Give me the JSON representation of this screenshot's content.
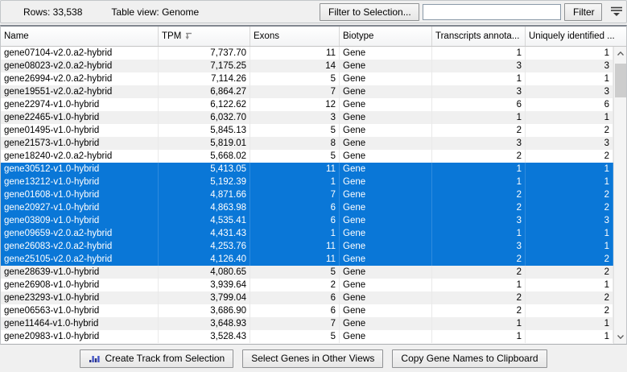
{
  "toolbar": {
    "rows_label": "Rows: 33,538",
    "view_label": "Table view: Genome",
    "filter_to_selection_label": "Filter to Selection...",
    "filter_input_value": "",
    "filter_button_label": "Filter",
    "filter_expand_icon": "filter-expand-icon"
  },
  "table": {
    "columns": [
      {
        "label": "Name",
        "sorted": false
      },
      {
        "label": "TPM",
        "sorted": true,
        "sort_icon": "sort-descending-icon"
      },
      {
        "label": "Exons",
        "sorted": false
      },
      {
        "label": "Biotype",
        "sorted": false
      },
      {
        "label": "Transcripts annota...",
        "sorted": false
      },
      {
        "label": "Uniquely identified ...",
        "sorted": false
      }
    ],
    "rows": [
      {
        "name": "gene07104-v2.0.a2-hybrid",
        "tpm": "7,737.70",
        "exons": "11",
        "biotype": "Gene",
        "transcripts": "1",
        "unique": "1",
        "selected": false
      },
      {
        "name": "gene08023-v2.0.a2-hybrid",
        "tpm": "7,175.25",
        "exons": "14",
        "biotype": "Gene",
        "transcripts": "3",
        "unique": "3",
        "selected": false
      },
      {
        "name": "gene26994-v2.0.a2-hybrid",
        "tpm": "7,114.26",
        "exons": "5",
        "biotype": "Gene",
        "transcripts": "1",
        "unique": "1",
        "selected": false
      },
      {
        "name": "gene19551-v2.0.a2-hybrid",
        "tpm": "6,864.27",
        "exons": "7",
        "biotype": "Gene",
        "transcripts": "3",
        "unique": "3",
        "selected": false
      },
      {
        "name": "gene22974-v1.0-hybrid",
        "tpm": "6,122.62",
        "exons": "12",
        "biotype": "Gene",
        "transcripts": "6",
        "unique": "6",
        "selected": false
      },
      {
        "name": "gene22465-v1.0-hybrid",
        "tpm": "6,032.70",
        "exons": "3",
        "biotype": "Gene",
        "transcripts": "1",
        "unique": "1",
        "selected": false
      },
      {
        "name": "gene01495-v1.0-hybrid",
        "tpm": "5,845.13",
        "exons": "5",
        "biotype": "Gene",
        "transcripts": "2",
        "unique": "2",
        "selected": false
      },
      {
        "name": "gene21573-v1.0-hybrid",
        "tpm": "5,819.01",
        "exons": "8",
        "biotype": "Gene",
        "transcripts": "3",
        "unique": "3",
        "selected": false
      },
      {
        "name": "gene18240-v2.0.a2-hybrid",
        "tpm": "5,668.02",
        "exons": "5",
        "biotype": "Gene",
        "transcripts": "2",
        "unique": "2",
        "selected": false
      },
      {
        "name": "gene30512-v1.0-hybrid",
        "tpm": "5,413.05",
        "exons": "11",
        "biotype": "Gene",
        "transcripts": "1",
        "unique": "1",
        "selected": true
      },
      {
        "name": "gene13212-v1.0-hybrid",
        "tpm": "5,192.39",
        "exons": "1",
        "biotype": "Gene",
        "transcripts": "1",
        "unique": "1",
        "selected": true
      },
      {
        "name": "gene01608-v1.0-hybrid",
        "tpm": "4,871.66",
        "exons": "7",
        "biotype": "Gene",
        "transcripts": "2",
        "unique": "2",
        "selected": true
      },
      {
        "name": "gene20927-v1.0-hybrid",
        "tpm": "4,863.98",
        "exons": "6",
        "biotype": "Gene",
        "transcripts": "2",
        "unique": "2",
        "selected": true
      },
      {
        "name": "gene03809-v1.0-hybrid",
        "tpm": "4,535.41",
        "exons": "6",
        "biotype": "Gene",
        "transcripts": "3",
        "unique": "3",
        "selected": true
      },
      {
        "name": "gene09659-v2.0.a2-hybrid",
        "tpm": "4,431.43",
        "exons": "1",
        "biotype": "Gene",
        "transcripts": "1",
        "unique": "1",
        "selected": true
      },
      {
        "name": "gene26083-v2.0.a2-hybrid",
        "tpm": "4,253.76",
        "exons": "11",
        "biotype": "Gene",
        "transcripts": "3",
        "unique": "1",
        "selected": true
      },
      {
        "name": "gene25105-v2.0.a2-hybrid",
        "tpm": "4,126.40",
        "exons": "11",
        "biotype": "Gene",
        "transcripts": "2",
        "unique": "2",
        "selected": true
      },
      {
        "name": "gene28639-v1.0-hybrid",
        "tpm": "4,080.65",
        "exons": "5",
        "biotype": "Gene",
        "transcripts": "2",
        "unique": "2",
        "selected": false
      },
      {
        "name": "gene26908-v1.0-hybrid",
        "tpm": "3,939.64",
        "exons": "2",
        "biotype": "Gene",
        "transcripts": "1",
        "unique": "1",
        "selected": false
      },
      {
        "name": "gene23293-v1.0-hybrid",
        "tpm": "3,799.04",
        "exons": "6",
        "biotype": "Gene",
        "transcripts": "2",
        "unique": "2",
        "selected": false
      },
      {
        "name": "gene06563-v1.0-hybrid",
        "tpm": "3,686.90",
        "exons": "6",
        "biotype": "Gene",
        "transcripts": "2",
        "unique": "2",
        "selected": false
      },
      {
        "name": "gene11464-v1.0-hybrid",
        "tpm": "3,648.93",
        "exons": "7",
        "biotype": "Gene",
        "transcripts": "1",
        "unique": "1",
        "selected": false
      },
      {
        "name": "gene20983-v1.0-hybrid",
        "tpm": "3,528.43",
        "exons": "5",
        "biotype": "Gene",
        "transcripts": "1",
        "unique": "1",
        "selected": false
      }
    ]
  },
  "footer": {
    "create_track_label": "Create Track from Selection",
    "select_genes_label": "Select Genes in Other Views",
    "copy_names_label": "Copy Gene Names to Clipboard"
  },
  "colors": {
    "selection_blue": "#0a77d7",
    "alt_row_gray": "#f0f0f0",
    "track_icon_blue": "#4355c8",
    "track_icon_navy": "#28307e"
  }
}
